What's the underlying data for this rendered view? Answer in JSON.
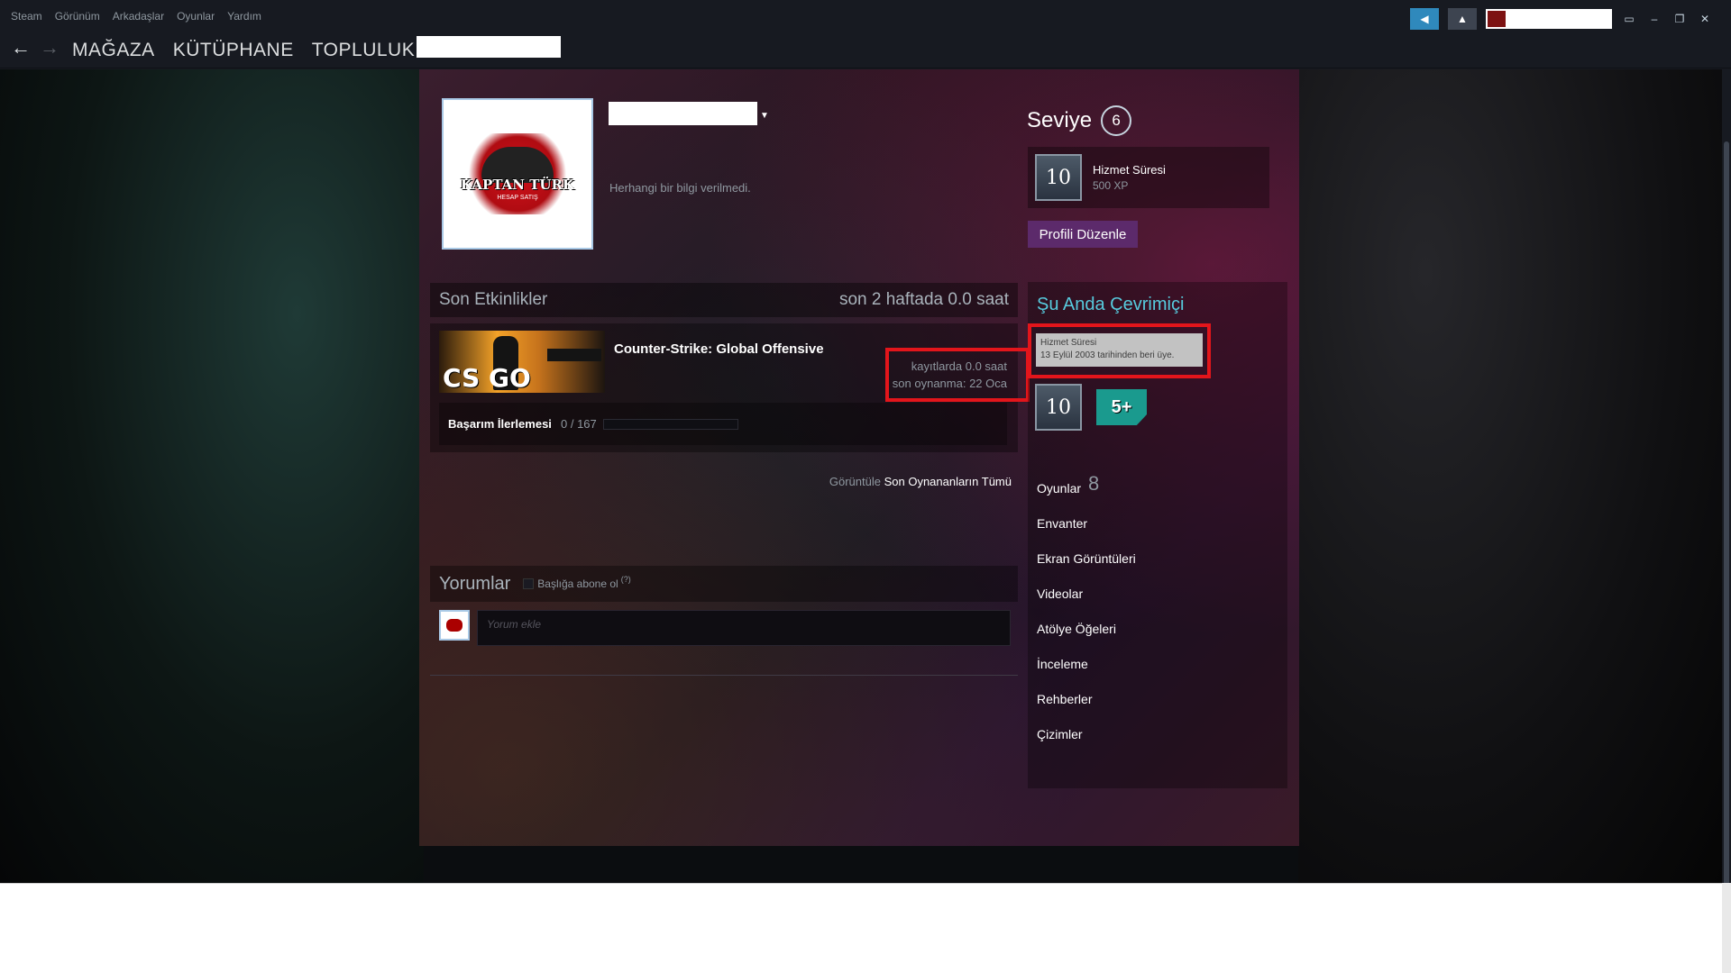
{
  "menu": [
    "Steam",
    "Görünüm",
    "Arkadaşlar",
    "Oyunlar",
    "Yardım"
  ],
  "nav": {
    "store": "MAĞAZA",
    "library": "KÜTÜPHANE",
    "community": "TOPLULUK"
  },
  "profile": {
    "summary": "Herhangi bir bilgi verilmedi.",
    "level_label": "Seviye",
    "level": "6",
    "badge": {
      "value": "10",
      "title": "Hizmet Süresi",
      "xp": "500 XP"
    },
    "edit_button": "Profili Düzenle",
    "logo_text": "KAPTAN TÜRK",
    "logo_sub": "HESAP SATIŞ"
  },
  "activity": {
    "title": "Son Etkinlikler",
    "hours_recent": "son 2 haftada 0.0 saat",
    "game": {
      "name": "Counter-Strike: Global Offensive",
      "logo": "CS GO",
      "hours_total": "kayıtlarda 0.0 saat",
      "last_played": "son oynanma: 22 Oca",
      "achievement_label": "Başarım İlerlemesi",
      "achievement_count": "0 / 167",
      "achievement_progress": 0
    },
    "view_prefix": "Görüntüle",
    "view_link": "Son Oynananların Tümü"
  },
  "comments": {
    "title": "Yorumlar",
    "subscribe": "Başlığa abone ol",
    "help": "(?)",
    "placeholder": "Yorum ekle"
  },
  "sidebar": {
    "status": "Şu Anda Çevrimiçi",
    "tooltip_title": "Hizmet Süresi",
    "tooltip_text": "13 Eylül 2003 tarihinden beri üye.",
    "badge1": "10",
    "badge2": "5+",
    "games_label": "Oyunlar",
    "games_count": "8",
    "links": [
      "Envanter",
      "Ekran Görüntüleri",
      "Videolar",
      "Atölye Öğeleri",
      "İnceleme",
      "Rehberler",
      "Çizimler"
    ]
  },
  "colors": {
    "accent_online": "#57cbde",
    "highlight": "#e3151b",
    "edit_button": "#5c2a6b"
  }
}
